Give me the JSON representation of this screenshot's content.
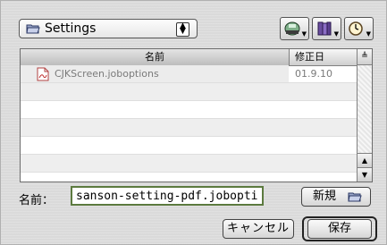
{
  "folder_popup": {
    "label": "Settings",
    "icon": "folder-icon"
  },
  "toolbar": {
    "buttons": [
      {
        "icon": "disk-icon"
      },
      {
        "icon": "books-icon"
      },
      {
        "icon": "clock-icon"
      }
    ]
  },
  "list": {
    "headers": {
      "name": "名前",
      "date": "修正日"
    },
    "files": [
      {
        "name": "CJKScreen.joboptions",
        "date": "01.9.10",
        "icon": "pdf-document-icon"
      }
    ]
  },
  "name_field": {
    "label": "名前：",
    "value": "sanson-setting-pdf.joboption"
  },
  "buttons": {
    "new": "新規",
    "cancel": "キャンセル",
    "save": "保存"
  }
}
